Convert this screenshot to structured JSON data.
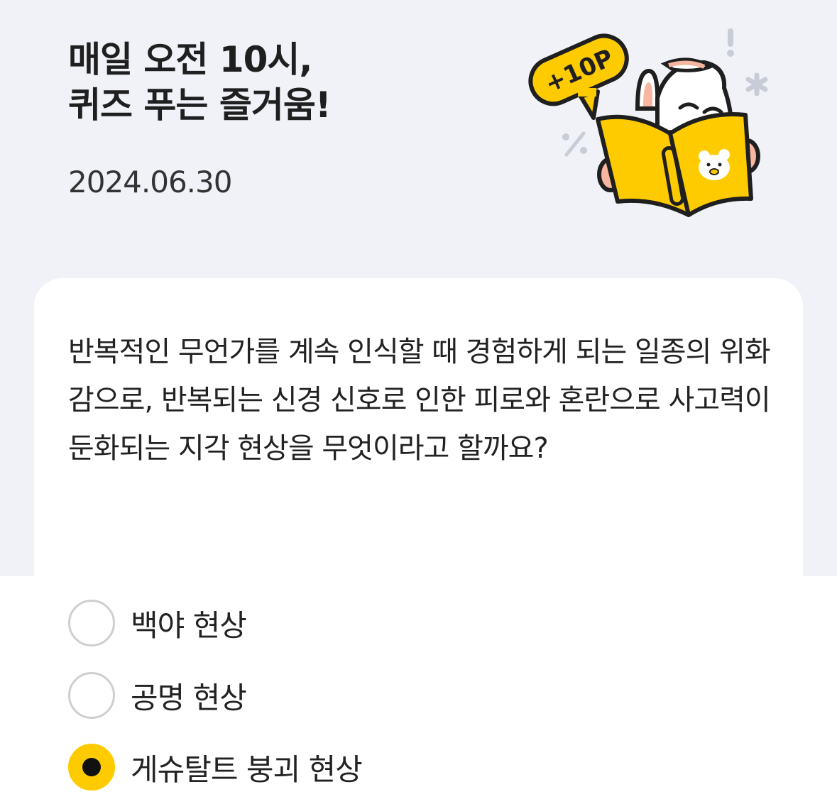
{
  "header": {
    "title_line1": "매일 오전 10시,",
    "title_line2": "퀴즈 푸는 즐거움!",
    "date": "2024.06.30"
  },
  "illustration": {
    "bubble_text": "+10P",
    "icon": "rabbit-reading-book-icon"
  },
  "quiz": {
    "question": "반복적인 무언가를 계속 인식할 때 경험하게 되는 일종의 위화감으로, 반복되는 신경 신호로 인한 피로와 혼란으로 사고력이 둔화되는 지각 현상을 무엇이라고 할까요?",
    "options": [
      {
        "label": "백야 현상",
        "selected": false
      },
      {
        "label": "공명 현상",
        "selected": false
      },
      {
        "label": "게슈탈트 붕괴 현상",
        "selected": true
      }
    ]
  },
  "colors": {
    "background": "#f0f2f7",
    "accent": "#fecb00",
    "radio_border": "#cfcfcf",
    "text": "#222222"
  }
}
